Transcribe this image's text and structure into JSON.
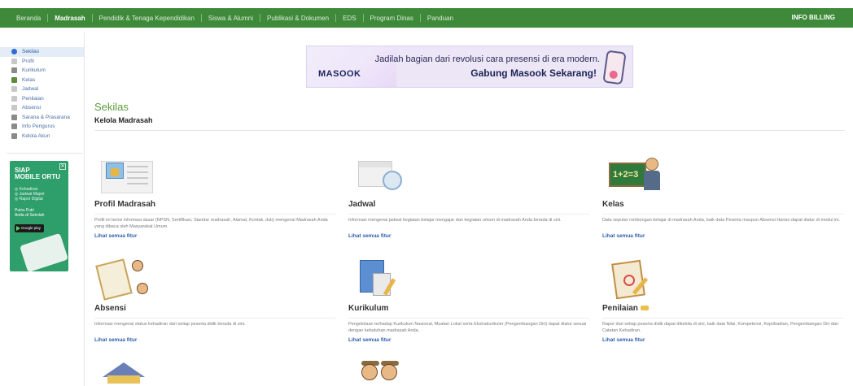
{
  "nav": {
    "items": [
      "Beranda",
      "Madrasah",
      "Pendidik & Tenaga Kependidikan",
      "Siswa & Alumni",
      "Publikasi & Dokumen",
      "EDS",
      "Program Dinas",
      "Panduan"
    ],
    "active": "Madrasah",
    "billing": "INFO BILLING",
    "color": "#3f8a3a"
  },
  "sidebar": {
    "items": [
      {
        "label": "Sekilas",
        "icon": "info-icon",
        "active": true
      },
      {
        "label": "Profil",
        "icon": "profile-card-icon"
      },
      {
        "label": "Kurikulum",
        "icon": "book-icon"
      },
      {
        "label": "Kelas",
        "icon": "class-icon"
      },
      {
        "label": "Jadwal",
        "icon": "calendar-icon"
      },
      {
        "label": "Penilaian",
        "icon": "grade-icon"
      },
      {
        "label": "Absensi",
        "icon": "attendance-icon"
      },
      {
        "label": "Sarana & Prasarana",
        "icon": "facility-icon"
      },
      {
        "label": "Info Pengurus",
        "icon": "person-icon"
      },
      {
        "label": "Kelola Akun",
        "icon": "gear-icon"
      }
    ]
  },
  "side_ad": {
    "title_line1": "SIAP",
    "title_line2": "MOBILE ORTU",
    "features": [
      "Kehadiran",
      "Jadwal Mapel",
      "Rapor Digital"
    ],
    "sub_line1": "Putra-Putri",
    "sub_line2": "Anda di Sekolah",
    "store": "Google play"
  },
  "banner": {
    "tagline": "Jadilah bagian dari revolusi cara presensi di era modern.",
    "cta": "Gabung Masook Sekarang!",
    "logo": "MASOOK"
  },
  "main": {
    "title": "Sekilas",
    "subtitle": "Kelola Madrasah",
    "link_label": "Lihat semua fitur"
  },
  "cards": [
    {
      "title": "Profil Madrasah",
      "desc": "Profil ini berisi informasi dasar (NPSN, Sertifikasi, Standar madrasah, Alamat, Kontak, dsb) mengenai Madrasah Anda yang dibaca oleh Masyarakat Umum.",
      "icon": "profile-icon"
    },
    {
      "title": "Jadwal",
      "desc": "Informasi mengenai jadwal kegiatan belajar mengajar dan kegiatan umum di madrasah Anda berada di sini.",
      "icon": "calendar-clock-icon"
    },
    {
      "title": "Kelas",
      "desc": "Data seputar rombongan belajar di madrasah Anda, baik data Peserta maupun Absensi Harian dapat diatur di modul ini.",
      "icon": "classroom-icon"
    },
    {
      "title": "Absensi",
      "desc": "Informasi mengenai status kehadiran dari setiap peserta didik berada di sini.",
      "icon": "attendance-icon"
    },
    {
      "title": "Kurikulum",
      "desc": "Pengelolaan terhadap Kurikulum Nasional, Muatan Lokal serta Ekstrakurikuler (Pengembangan Diri) dapat diatur sesuai dengan kebutuhan madrasah Anda.",
      "icon": "curriculum-icon"
    },
    {
      "title": "Penilaian",
      "desc": "Rapor dari setiap peserta didik dapat dikelola di sini, baik data Nilai, Kompetensi, Kepribadian, Pengembangan Diri dan Catatan Kehadiran.",
      "icon": "grading-icon",
      "badge": true
    }
  ]
}
